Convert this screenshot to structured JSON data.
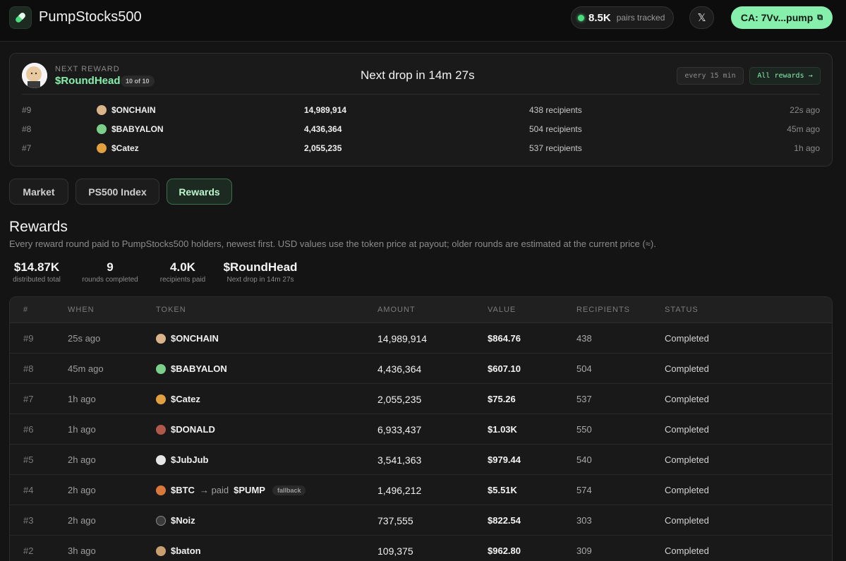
{
  "header": {
    "brand": "PumpStocks500",
    "pairs_count": "8.5K",
    "pairs_label": "pairs tracked",
    "x_label": "𝕏",
    "ca_label": "CA: 7Vv...pump",
    "copy_icon": "⧉"
  },
  "next_reward": {
    "label": "NEXT REWARD",
    "name": "$RoundHead",
    "count": "10 of 10",
    "countdown": "Next drop in 14m 27s",
    "interval": "every 15 min",
    "all_rewards": "All rewards →",
    "recent": [
      {
        "idx": "#9",
        "token": "$ONCHAIN",
        "amount": "14,989,914",
        "recipients": "438 recipients",
        "time": "22s ago",
        "icon_color": "#d9b48a"
      },
      {
        "idx": "#8",
        "token": "$BABYALON",
        "amount": "4,436,364",
        "recipients": "504 recipients",
        "time": "45m ago",
        "icon_color": "#7ccf8a"
      },
      {
        "idx": "#7",
        "token": "$Catez",
        "amount": "2,055,235",
        "recipients": "537 recipients",
        "time": "1h ago",
        "icon_color": "#e0a040"
      }
    ]
  },
  "tabs": [
    "Market",
    "PS500 Index",
    "Rewards"
  ],
  "section": {
    "title": "Rewards",
    "description": "Every reward round paid to PumpStocks500 holders, newest first. USD values use the token price at payout; older rounds are estimated at the current price (≈)."
  },
  "stats": [
    {
      "value": "$14.87K",
      "label": "distributed total"
    },
    {
      "value": "9",
      "label": "rounds completed"
    },
    {
      "value": "4.0K",
      "label": "recipients paid"
    },
    {
      "value": "$RoundHead",
      "label": "Next drop in 14m 27s"
    }
  ],
  "table": {
    "columns": [
      "#",
      "WHEN",
      "TOKEN",
      "AMOUNT",
      "VALUE",
      "RECIPIENTS",
      "STATUS"
    ],
    "rows": [
      {
        "idx": "#9",
        "when": "25s ago",
        "token": "$ONCHAIN",
        "amount": "14,989,914",
        "value": "$864.76",
        "recipients": "438",
        "status": "Completed",
        "icon_color": "#d9b48a"
      },
      {
        "idx": "#8",
        "when": "45m ago",
        "token": "$BABYALON",
        "amount": "4,436,364",
        "value": "$607.10",
        "recipients": "504",
        "status": "Completed",
        "icon_color": "#7ccf8a"
      },
      {
        "idx": "#7",
        "when": "1h ago",
        "token": "$Catez",
        "amount": "2,055,235",
        "value": "$75.26",
        "recipients": "537",
        "status": "Completed",
        "icon_color": "#e0a040"
      },
      {
        "idx": "#6",
        "when": "1h ago",
        "token": "$DONALD",
        "amount": "6,933,437",
        "value": "$1.03K",
        "recipients": "550",
        "status": "Completed",
        "icon_color": "#b0584a"
      },
      {
        "idx": "#5",
        "when": "2h ago",
        "token": "$JubJub",
        "amount": "3,541,363",
        "value": "$979.44",
        "recipients": "540",
        "status": "Completed",
        "icon_color": "#e6e6e6"
      },
      {
        "idx": "#4",
        "when": "2h ago",
        "token": "$BTC",
        "paid_text": "→ paid",
        "paid_token": "$PUMP",
        "fallback": "fallback",
        "amount": "1,496,212",
        "value": "$5.51K",
        "recipients": "574",
        "status": "Completed",
        "icon_color": "#d9783a"
      },
      {
        "idx": "#3",
        "when": "2h ago",
        "token": "$Noiz",
        "amount": "737,555",
        "value": "$822.54",
        "recipients": "303",
        "status": "Completed",
        "icon_color": "#3a3a3a"
      },
      {
        "idx": "#2",
        "when": "3h ago",
        "token": "$baton",
        "amount": "109,375",
        "value": "$962.80",
        "recipients": "309",
        "status": "Completed",
        "icon_color": "#c8a070"
      }
    ]
  }
}
